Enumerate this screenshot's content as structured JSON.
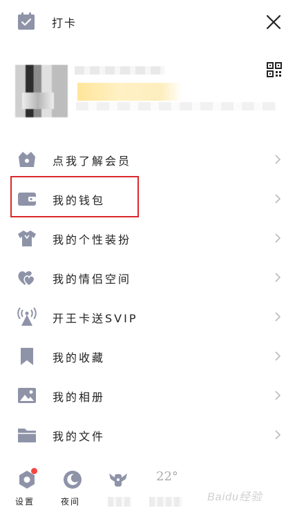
{
  "header": {
    "checkin_label": "打卡"
  },
  "menu": {
    "items": [
      {
        "label": "点我了解会员",
        "icon": "crown-bag-icon"
      },
      {
        "label": "我的钱包",
        "icon": "wallet-icon"
      },
      {
        "label": "我的个性装扮",
        "icon": "tshirt-icon"
      },
      {
        "label": "我的情侣空间",
        "icon": "couple-hearts-icon"
      },
      {
        "label": "开王卡送SVIP",
        "icon": "signal-tower-icon"
      },
      {
        "label": "我的收藏",
        "icon": "bookmark-icon"
      },
      {
        "label": "我的相册",
        "icon": "photo-icon"
      },
      {
        "label": "我的文件",
        "icon": "folder-icon"
      }
    ]
  },
  "bottom": {
    "settings_label": "设置",
    "night_label": "夜间",
    "weather_temp": "22°"
  },
  "watermark": "Baidu经验",
  "colors": {
    "icon": "#8e93a8",
    "highlight": "#d9262b",
    "badge": "#f4473f"
  }
}
